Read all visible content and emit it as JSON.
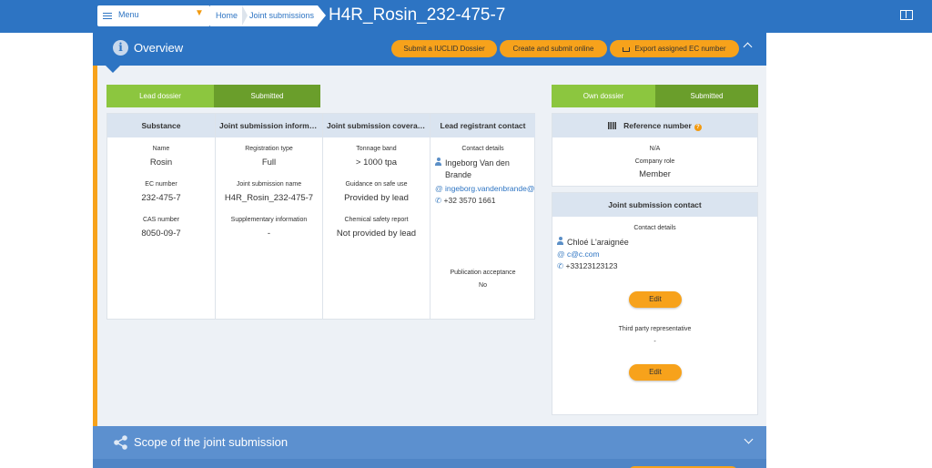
{
  "header": {
    "menu_label": "Menu",
    "breadcrumb": [
      "Home",
      "Joint submissions"
    ],
    "title": "H4R_Rosin_232-475-7"
  },
  "overview": {
    "title": "Overview",
    "buttons": {
      "iuclid": "Submit a IUCLID Dossier",
      "create": "Create and submit online",
      "export": "Export assigned EC number"
    },
    "lead_status": {
      "label": "Lead dossier",
      "value": "Submitted"
    },
    "own_status": {
      "label": "Own dossier",
      "value": "Submitted"
    },
    "substance": {
      "header": "Substance",
      "name_label": "Name",
      "name": "Rosin",
      "ec_label": "EC number",
      "ec": "232-475-7",
      "cas_label": "CAS number",
      "cas": "8050-09-7"
    },
    "js_info": {
      "header": "Joint submission information",
      "reg_type_label": "Registration type",
      "reg_type": "Full",
      "js_name_label": "Joint submission name",
      "js_name": "H4R_Rosin_232-475-7",
      "supp_label": "Supplementary information",
      "supp": "-"
    },
    "js_coverage": {
      "header": "Joint submission coverage",
      "tonnage_label": "Tonnage band",
      "tonnage": "> 1000 tpa",
      "guidance_label": "Guidance on safe use",
      "guidance": "Provided by lead",
      "csr_label": "Chemical safety report",
      "csr": "Not provided by lead"
    },
    "lead_contact": {
      "header": "Lead registrant contact",
      "details_label": "Contact details",
      "name_line1": "Ingeborg Van den",
      "name_line2": "Brande",
      "email": "ingeborg.vandenbrande@",
      "phone": "+32 3570 1661",
      "pub_label": "Publication acceptance",
      "pub": "No"
    },
    "reference": {
      "header": "Reference number",
      "value": "N/A",
      "role_label": "Company role",
      "role": "Member"
    },
    "js_contact": {
      "header": "Joint submission contact",
      "details_label": "Contact details",
      "name": "Chloé L'araignée",
      "email": "c@c.com",
      "phone": "+33123123123",
      "edit1": "Edit",
      "third_party_label": "Third party representative",
      "third_party": "-",
      "edit2": "Edit"
    }
  },
  "scope": {
    "title": "Scope of the joint submission"
  },
  "colors": {
    "primary": "#2d74c3",
    "accent": "#f7a21b",
    "green_light": "#8cc63f",
    "green_dark": "#6a9e2b"
  },
  "icons": [
    "hamburger-icon",
    "chevron-down-icon",
    "book-icon",
    "info-icon",
    "download-icon",
    "user-icon",
    "at-icon",
    "phone-icon",
    "barcode-icon",
    "help-icon",
    "share-icon",
    "chevron-up-icon"
  ]
}
